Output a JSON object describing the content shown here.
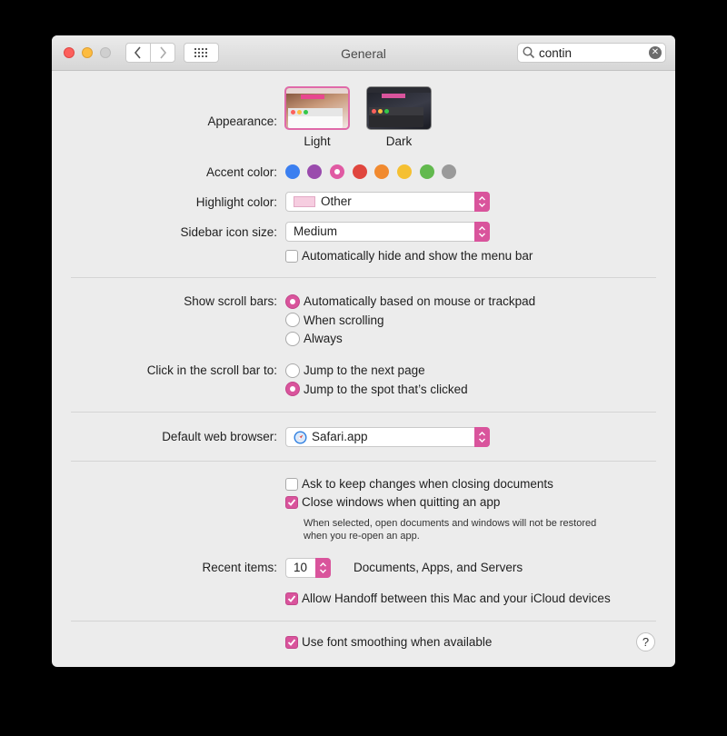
{
  "window": {
    "title": "General"
  },
  "search": {
    "value": "contin"
  },
  "appearance": {
    "label": "Appearance:",
    "options": [
      {
        "label": "Light",
        "selected": true
      },
      {
        "label": "Dark",
        "selected": false
      }
    ]
  },
  "accent": {
    "label": "Accent color:",
    "colors": [
      "#3b7ff0",
      "#9a4bad",
      "#e05aa3",
      "#e0463e",
      "#f18a2f",
      "#f5c032",
      "#62b94e",
      "#9a9a9a"
    ],
    "selected_index": 2
  },
  "highlight": {
    "label": "Highlight color:",
    "value": "Other",
    "swatch_color": "#f6cde0"
  },
  "sidebar_icon_size": {
    "label": "Sidebar icon size:",
    "value": "Medium"
  },
  "menu_bar_autohide": {
    "label": "Automatically hide and show the menu bar",
    "checked": false
  },
  "scroll_bars": {
    "label": "Show scroll bars:",
    "options": [
      "Automatically based on mouse or trackpad",
      "When scrolling",
      "Always"
    ],
    "selected_index": 0
  },
  "click_scroll_bar": {
    "label": "Click in the scroll bar to:",
    "options": [
      "Jump to the next page",
      "Jump to the spot that’s clicked"
    ],
    "selected_index": 1
  },
  "default_browser": {
    "label": "Default web browser:",
    "value": "Safari.app"
  },
  "ask_keep_changes": {
    "label": "Ask to keep changes when closing documents",
    "checked": false
  },
  "close_windows": {
    "label": "Close windows when quitting an app",
    "checked": true,
    "note_line1": "When selected, open documents and windows will not be restored",
    "note_line2": "when you re-open an app."
  },
  "recent_items": {
    "label": "Recent items:",
    "value": "10",
    "suffix": "Documents, Apps, and Servers"
  },
  "handoff": {
    "label": "Allow Handoff between this Mac and your iCloud devices",
    "checked": true
  },
  "font_smoothing": {
    "label": "Use font smoothing when available",
    "checked": true
  },
  "help": {
    "label": "?"
  },
  "colors": {
    "accent": "#d9549c"
  }
}
